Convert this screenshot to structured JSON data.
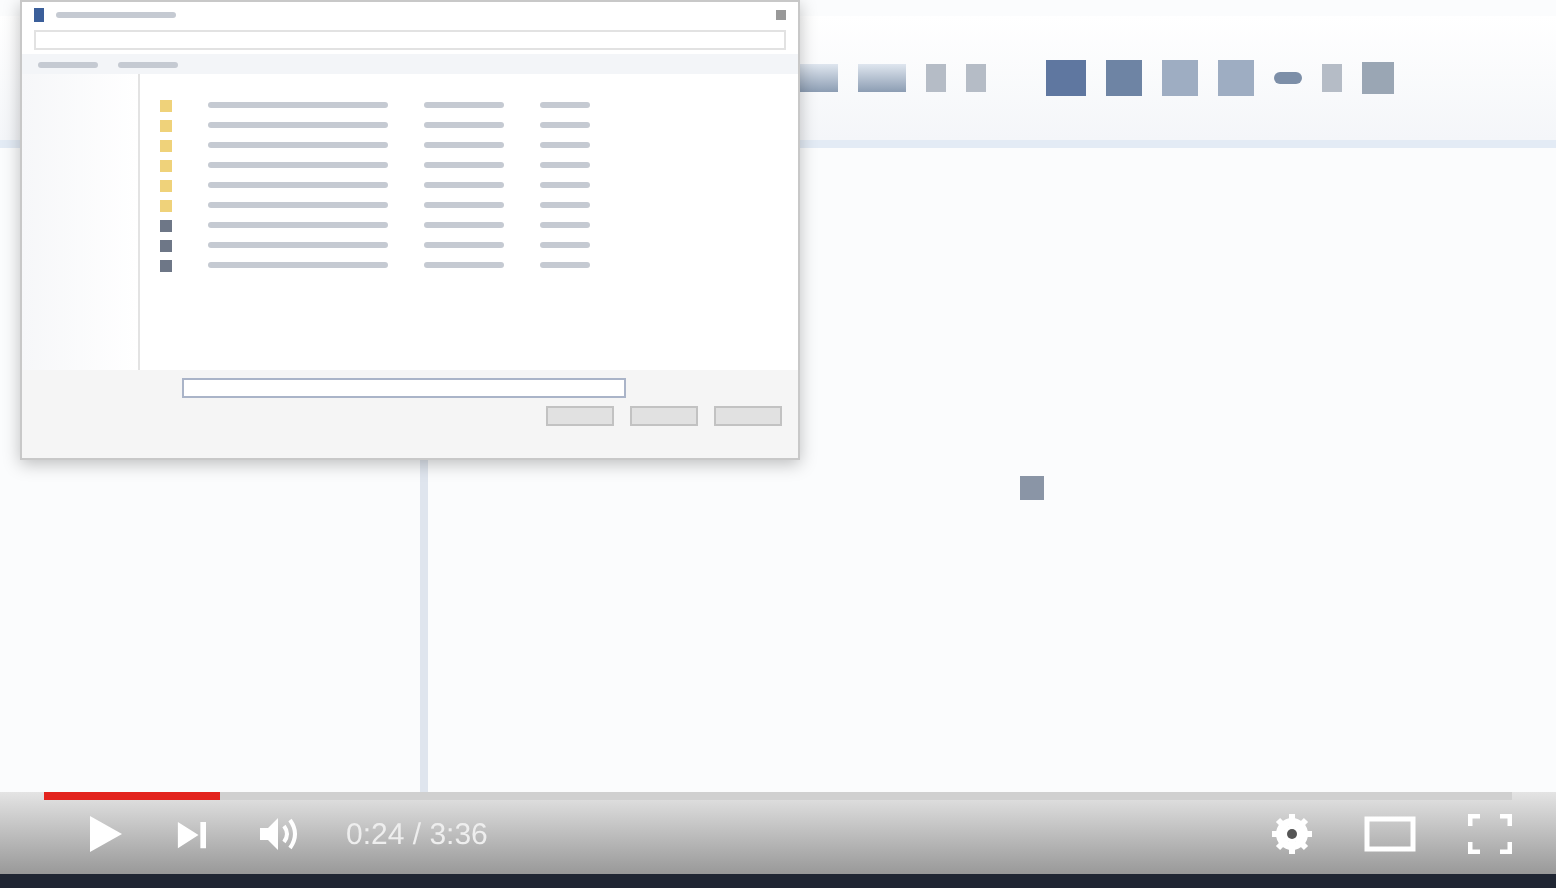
{
  "dialog": {
    "files": [
      {
        "kind": "folder"
      },
      {
        "kind": "folder"
      },
      {
        "kind": "folder"
      },
      {
        "kind": "folder"
      },
      {
        "kind": "folder"
      },
      {
        "kind": "folder"
      },
      {
        "kind": "file"
      },
      {
        "kind": "file"
      },
      {
        "kind": "file"
      }
    ]
  },
  "player": {
    "progress": {
      "level": 0.12
    },
    "time": "0:24 / 3:36"
  }
}
